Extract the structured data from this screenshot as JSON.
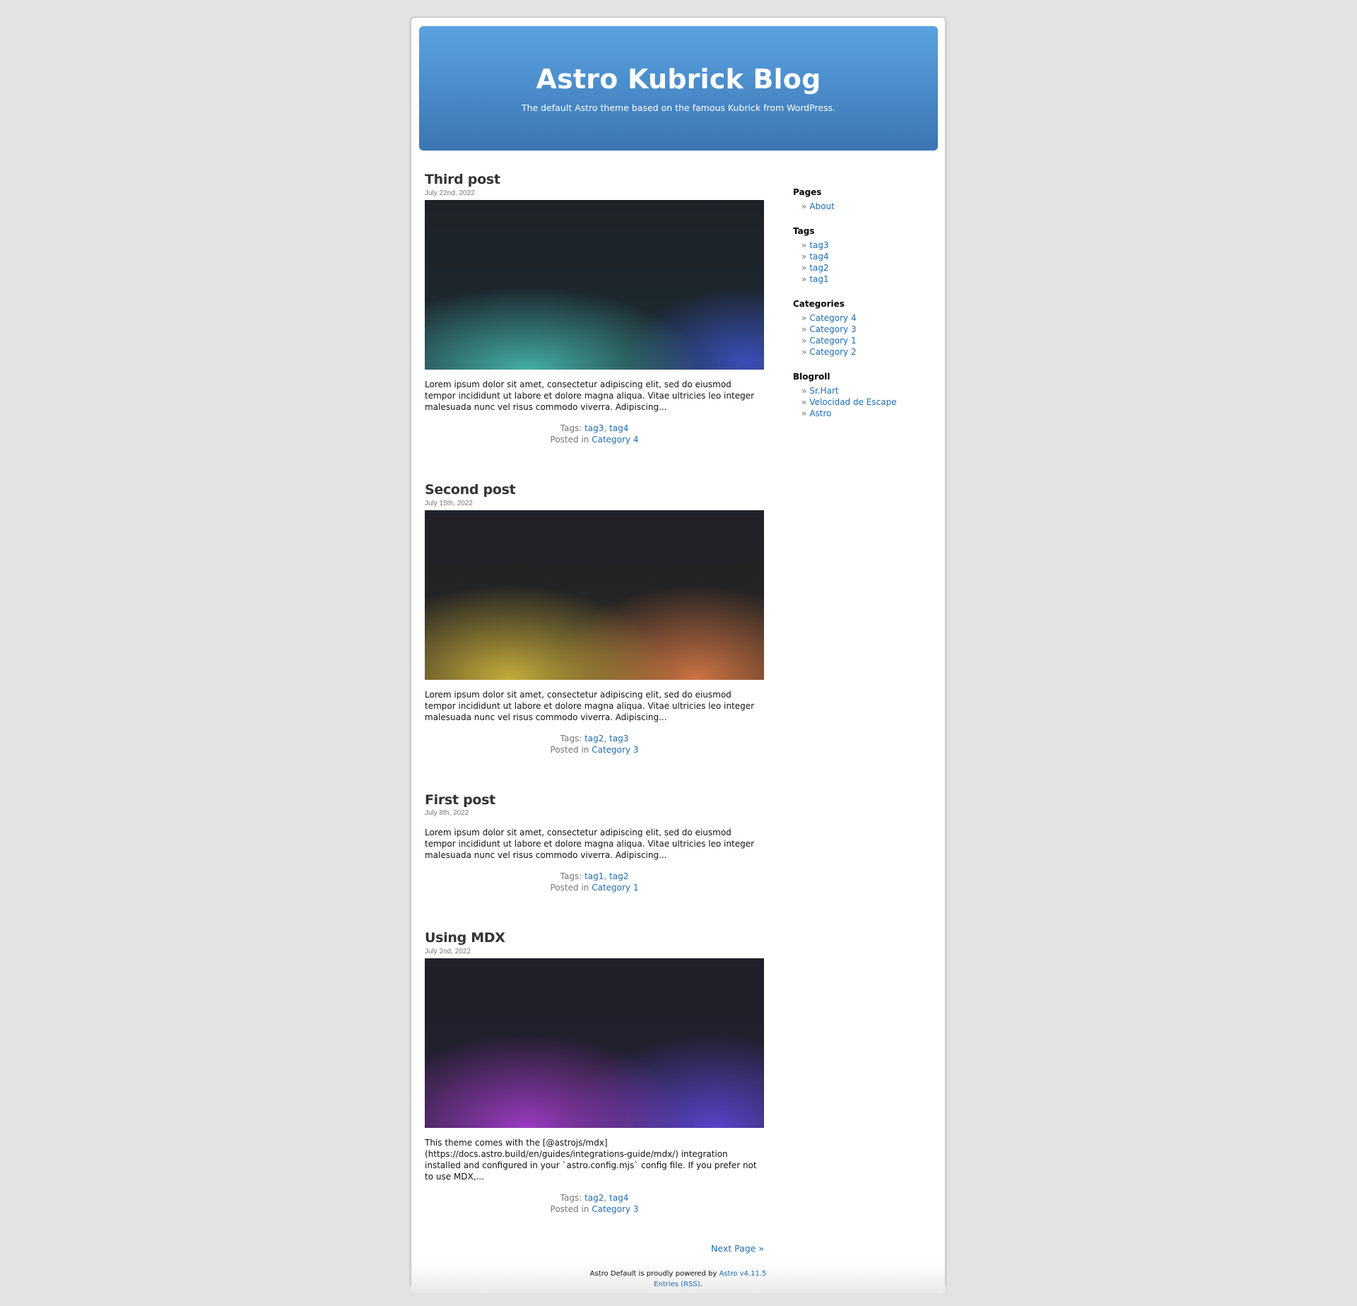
{
  "header": {
    "title": "Astro Kubrick Blog",
    "description": "The default Astro theme based on the famous Kubrick from WordPress."
  },
  "posts": [
    {
      "title": "Third post",
      "date": "July 22nd, 2022",
      "excerpt": "Lorem ipsum dolor sit amet, consectetur adipiscing elit, sed do eiusmod tempor incididunt ut labore et dolore magna aliqua. Vitae ultricies leo integer malesuada nunc vel risus commodo viverra. Adipiscing...",
      "tags_label": "Tags:",
      "tags": [
        "tag3",
        "tag4"
      ],
      "posted_label": "Posted in",
      "category": "Category 4"
    },
    {
      "title": "Second post",
      "date": "July 15th, 2022",
      "excerpt": "Lorem ipsum dolor sit amet, consectetur adipiscing elit, sed do eiusmod tempor incididunt ut labore et dolore magna aliqua. Vitae ultricies leo integer malesuada nunc vel risus commodo viverra. Adipiscing...",
      "tags_label": "Tags:",
      "tags": [
        "tag2",
        "tag3"
      ],
      "posted_label": "Posted in",
      "category": "Category 3"
    },
    {
      "title": "First post",
      "date": "July 8th, 2022",
      "excerpt": "Lorem ipsum dolor sit amet, consectetur adipiscing elit, sed do eiusmod tempor incididunt ut labore et dolore magna aliqua. Vitae ultricies leo integer malesuada nunc vel risus commodo viverra. Adipiscing...",
      "tags_label": "Tags:",
      "tags": [
        "tag1",
        "tag2"
      ],
      "posted_label": "Posted in",
      "category": "Category 1"
    },
    {
      "title": "Using MDX",
      "date": "July 2nd, 2022",
      "excerpt": "This theme comes with the [@astrojs/mdx](https://docs.astro.build/en/guides/integrations-guide/mdx/) integration installed and configured in your `astro.config.mjs` config file. If you prefer not to use MDX,...",
      "tags_label": "Tags:",
      "tags": [
        "tag2",
        "tag4"
      ],
      "posted_label": "Posted in",
      "category": "Category 3"
    }
  ],
  "pagination": {
    "next_label": "Next Page »"
  },
  "sidebar": {
    "pages": {
      "heading": "Pages",
      "items": [
        "About"
      ]
    },
    "tags": {
      "heading": "Tags",
      "items": [
        "tag3",
        "tag4",
        "tag2",
        "tag1"
      ]
    },
    "categories": {
      "heading": "Categories",
      "items": [
        "Category 4",
        "Category 3",
        "Category 1",
        "Category 2"
      ]
    },
    "blogroll": {
      "heading": "Blogroll",
      "items": [
        "Sr.Hart",
        "Velocidad de Escape",
        "Astro"
      ]
    }
  },
  "footer": {
    "powered_text": "Astro Default is proudly powered by",
    "astro_link": "Astro v4.11.5",
    "rss_link": "Entries (RSS)",
    "rss_suffix": "."
  },
  "colors": {
    "header_top": "#5aa2e1",
    "header_bottom": "#3b76b3",
    "link": "#1f6db3",
    "background": "#e3e3e3"
  }
}
